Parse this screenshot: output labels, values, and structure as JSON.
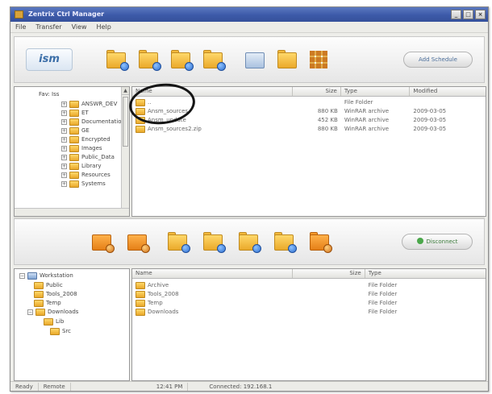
{
  "window": {
    "title": "Zentrix Ctrl Manager",
    "controls": [
      "_",
      "□",
      "×"
    ]
  },
  "menu": [
    "File",
    "Transfer",
    "View",
    "Help"
  ],
  "top_toolbar": {
    "logo": "ism",
    "icons": [
      "folder-upload-icon",
      "folder-download-icon",
      "folder-refresh-icon",
      "folder-sync-icon",
      "document-icon",
      "copy-icon",
      "grid-icon"
    ],
    "action": "Add Schedule"
  },
  "remote_tree": {
    "root": "Fav: Iss",
    "items": [
      "ANSWR_DEV",
      "ET",
      "Documentation",
      "GE",
      "Encrypted",
      "Images",
      "Public_Data",
      "Library",
      "Resources",
      "Systems"
    ]
  },
  "remote_list": {
    "columns": [
      "Name",
      "Size",
      "Type",
      "Modified"
    ],
    "rows": [
      {
        "name": "..",
        "size": "",
        "type": "File Folder",
        "modified": ""
      },
      {
        "name": "Ansm_sources",
        "size": "880 KB",
        "type": "WinRAR archive",
        "modified": "2009-03-05"
      },
      {
        "name": "Ansm_update",
        "size": "452 KB",
        "type": "WinRAR archive",
        "modified": "2009-03-05"
      },
      {
        "name": "Ansm_sources2.zip",
        "size": "880 KB",
        "type": "WinRAR archive",
        "modified": "2009-03-05"
      }
    ]
  },
  "bottom_toolbar": {
    "icons": [
      "upload-file-icon",
      "download-file-icon",
      "folder-upload-icon",
      "folder-download-icon",
      "folder-sync-icon",
      "folder-move-icon",
      "folder-delete-icon"
    ],
    "action": "Disconnect"
  },
  "local_tree": {
    "root": "Workstation",
    "items": [
      "Public",
      "Tools_2008",
      "Temp",
      "Downloads",
      "Lib",
      "Src"
    ]
  },
  "local_list": {
    "columns": [
      "Name",
      "Size",
      "Type"
    ],
    "rows": [
      {
        "name": "Archive",
        "size": "",
        "type": "File Folder"
      },
      {
        "name": "Tools_2008",
        "size": "",
        "type": "File Folder"
      },
      {
        "name": "Temp",
        "size": "",
        "type": "File Folder"
      },
      {
        "name": "Downloads",
        "size": "",
        "type": "File Folder"
      }
    ]
  },
  "status": [
    "Ready",
    "Remote",
    "12:41 PM",
    "Connected: 192.168.1"
  ]
}
